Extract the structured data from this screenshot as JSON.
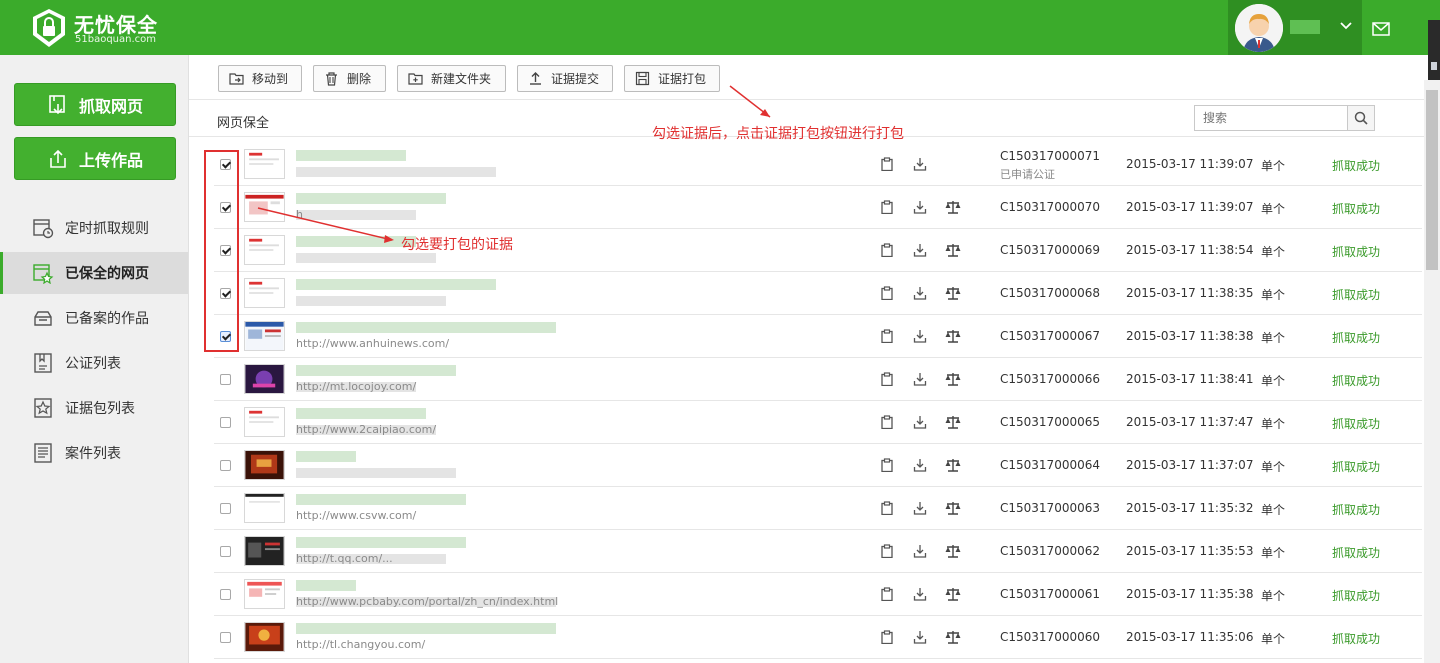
{
  "app": {
    "logo_title": "无忧保全",
    "logo_sub": "51baoquan.com"
  },
  "header": {
    "mail_icon": "mail-icon",
    "caret_icon": "chevron-down-icon"
  },
  "sidebar": {
    "primary_buttons": [
      {
        "label": "抓取网页",
        "icon": "capture-page-icon"
      },
      {
        "label": "上传作品",
        "icon": "upload-icon"
      }
    ],
    "items": [
      {
        "label": "定时抓取规则",
        "icon": "timer-rule-icon",
        "active": false
      },
      {
        "label": "已保全的网页",
        "icon": "saved-pages-icon",
        "active": true
      },
      {
        "label": "已备案的作品",
        "icon": "filed-works-icon",
        "active": false
      },
      {
        "label": "公证列表",
        "icon": "notary-list-icon",
        "active": false
      },
      {
        "label": "证据包列表",
        "icon": "evidence-package-icon",
        "active": false
      },
      {
        "label": "案件列表",
        "icon": "case-list-icon",
        "active": false
      }
    ]
  },
  "toolbar": {
    "buttons": [
      {
        "label": "移动到",
        "icon": "move-icon"
      },
      {
        "label": "删除",
        "icon": "trash-icon"
      },
      {
        "label": "新建文件夹",
        "icon": "new-folder-icon"
      },
      {
        "label": "证据提交",
        "icon": "submit-icon"
      },
      {
        "label": "证据打包",
        "icon": "package-icon"
      }
    ]
  },
  "main": {
    "section_title": "网页保全",
    "search_placeholder": "搜索"
  },
  "annotations": {
    "pack_hint": "勾选证据后，点击证据打包按钮进行打包",
    "select_hint": "勾选要打包的证据",
    "color": "#e03030"
  },
  "rows": [
    {
      "checked": true,
      "code": "C150317000071",
      "sub": "已申请公证",
      "time": "2015-03-17 11:39:07",
      "type": "单个",
      "status": "抓取成功",
      "url": "",
      "has_scale": false,
      "thumb": "white"
    },
    {
      "checked": true,
      "code": "C150317000070",
      "sub": "",
      "time": "2015-03-17 11:39:07",
      "type": "单个",
      "status": "抓取成功",
      "url": "h",
      "has_scale": true,
      "thumb": "red"
    },
    {
      "checked": true,
      "code": "C150317000069",
      "sub": "",
      "time": "2015-03-17 11:38:54",
      "type": "单个",
      "status": "抓取成功",
      "url": "",
      "has_scale": true,
      "thumb": "white"
    },
    {
      "checked": true,
      "code": "C150317000068",
      "sub": "",
      "time": "2015-03-17 11:38:35",
      "type": "单个",
      "status": "抓取成功",
      "url": "",
      "has_scale": true,
      "thumb": "white"
    },
    {
      "checked": true,
      "code": "C150317000067",
      "sub": "",
      "time": "2015-03-17 11:38:38",
      "type": "单个",
      "status": "抓取成功",
      "url": "http://www.anhuinews.com/",
      "has_scale": true,
      "thumb": "site"
    },
    {
      "checked": false,
      "code": "C150317000066",
      "sub": "",
      "time": "2015-03-17 11:38:41",
      "type": "单个",
      "status": "抓取成功",
      "url": "http://mt.locojoy.com/",
      "has_scale": true,
      "thumb": "purple"
    },
    {
      "checked": false,
      "code": "C150317000065",
      "sub": "",
      "time": "2015-03-17 11:37:47",
      "type": "单个",
      "status": "抓取成功",
      "url": "http://www.2caipiao.com/",
      "has_scale": true,
      "thumb": "white"
    },
    {
      "checked": false,
      "code": "C150317000064",
      "sub": "",
      "time": "2015-03-17 11:37:07",
      "type": "单个",
      "status": "抓取成功",
      "url": "",
      "has_scale": true,
      "thumb": "game"
    },
    {
      "checked": false,
      "code": "C150317000063",
      "sub": "",
      "time": "2015-03-17 11:35:32",
      "type": "单个",
      "status": "抓取成功",
      "url": "http://www.csvw.com/",
      "has_scale": true,
      "thumb": "white2"
    },
    {
      "checked": false,
      "code": "C150317000062",
      "sub": "",
      "time": "2015-03-17 11:35:53",
      "type": "单个",
      "status": "抓取成功",
      "url": "http://t.qq.com/...",
      "has_scale": true,
      "thumb": "dark"
    },
    {
      "checked": false,
      "code": "C150317000061",
      "sub": "",
      "time": "2015-03-17 11:35:38",
      "type": "单个",
      "status": "抓取成功",
      "url": "http://www.pcbaby.com/portal/zh_cn/index.html",
      "has_scale": true,
      "thumb": "site2"
    },
    {
      "checked": false,
      "code": "C150317000060",
      "sub": "",
      "time": "2015-03-17 11:35:06",
      "type": "单个",
      "status": "抓取成功",
      "url": "http://tl.changyou.com/",
      "has_scale": true,
      "thumb": "game2"
    }
  ]
}
